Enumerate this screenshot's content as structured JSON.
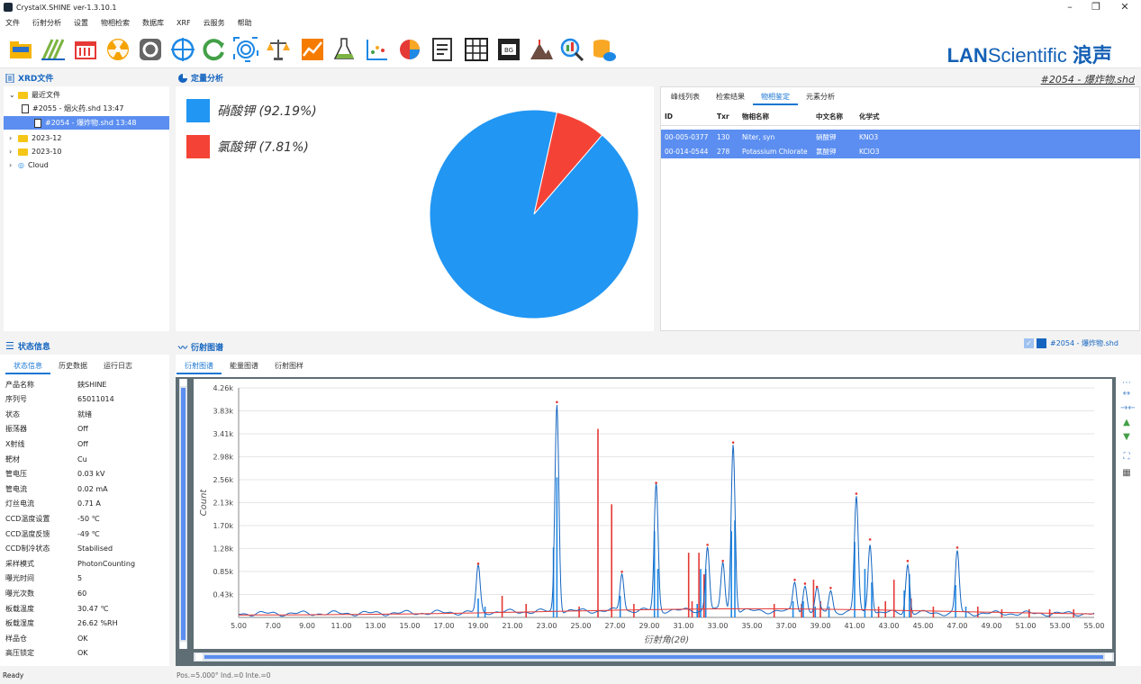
{
  "window": {
    "title": "CrystalX.SHINE  ver-1.3.10.1"
  },
  "menu": [
    "文件",
    "衍射分析",
    "设置",
    "物相检索",
    "数据库",
    "XRF",
    "云服务",
    "帮助"
  ],
  "toolbar_icons": [
    "folder-icon",
    "grid-icon",
    "calendar-icon",
    "radiation-icon",
    "gear-icon",
    "crosshair-icon",
    "refresh-icon",
    "fingerprint-icon",
    "balance-icon",
    "line-chart-icon",
    "flask-icon",
    "scatter-icon",
    "pie-icon",
    "report-icon",
    "table-icon",
    "bg-icon",
    "mountain-icon",
    "magnifier-icon",
    "database-cloud-icon"
  ],
  "brand": {
    "bold": "LAN",
    "rest": "Scientific",
    "cn": "浪声"
  },
  "xrd_files": {
    "header": "XRD文件",
    "recent": "最近文件",
    "files": [
      "#2055 - 烟火药.shd 13:47",
      "#2054 - 爆炸物.shd 13:48"
    ],
    "folders": [
      "2023-12",
      "2023-10",
      "Cloud"
    ]
  },
  "quant": {
    "header": "定量分析",
    "legend": [
      {
        "label": "硝酸钾 (92.19%)",
        "color": "#2196f3"
      },
      {
        "label": "氯酸钾 (7.81%)",
        "color": "#f44336"
      }
    ],
    "chart_data": {
      "type": "pie",
      "labels": [
        "硝酸钾",
        "氯酸钾"
      ],
      "values": [
        92.19,
        7.81
      ],
      "colors": [
        "#2196f3",
        "#f44336"
      ]
    }
  },
  "file_title": "#2054 - 爆炸物.shd",
  "result_tabs": [
    "峰线列表",
    "检索结果",
    "物相鉴定",
    "元素分析"
  ],
  "result_table": {
    "headers": [
      "ID",
      "Txr",
      "物相名称",
      "中文名称",
      "化学式"
    ],
    "rows": [
      [
        "00-005-0377",
        "130",
        "Niter, syn",
        "硝酸钾",
        "KNO3"
      ],
      [
        "00-014-0544",
        "278",
        "Potassium Chlorate",
        "氯酸钾",
        "KClO3"
      ]
    ]
  },
  "status": {
    "header": "状态信息",
    "tabs": [
      "状态信息",
      "历史数据",
      "运行日志"
    ],
    "items": [
      [
        "产品名称",
        "鉠SHINE"
      ],
      [
        "序列号",
        "65011014"
      ],
      [
        "状态",
        "就绪"
      ],
      [
        "振荡器",
        "Off"
      ],
      [
        "X射线",
        "Off"
      ],
      [
        "靶材",
        "Cu"
      ],
      [
        "管电压",
        "0.03 kV"
      ],
      [
        "管电流",
        "0.02 mA"
      ],
      [
        "灯丝电流",
        "0.71 A"
      ],
      [
        "CCD温度设置",
        "-50 ℃"
      ],
      [
        "CCD温度反馈",
        "-49 ℃"
      ],
      [
        "CCD制冷状态",
        "Stabilised"
      ],
      [
        "采样模式",
        "PhotonCounting"
      ],
      [
        "曝光时间",
        "5"
      ],
      [
        "曝光次数",
        "60"
      ],
      [
        "板载温度",
        "30.47 ℃"
      ],
      [
        "板载湿度",
        "26.62 %RH"
      ],
      [
        "样品仓",
        "OK"
      ],
      [
        "高压锁定",
        "OK"
      ]
    ]
  },
  "diffraction": {
    "header": "衍射图谱",
    "tabs": [
      "衍射图谱",
      "能量图谱",
      "衍射图样"
    ],
    "legend_label": "#2054 - 爆炸物.shd",
    "chart_data": {
      "type": "line",
      "xlabel": "衍射角(2θ)",
      "ylabel": "Count",
      "xlim": [
        5,
        55
      ],
      "ylim": [
        0,
        4260
      ],
      "x_ticks": [
        "5.00",
        "7.00",
        "9.00",
        "11.00",
        "13.00",
        "15.00",
        "17.00",
        "19.00",
        "21.00",
        "23.00",
        "25.00",
        "27.00",
        "29.00",
        "31.00",
        "33.00",
        "35.00",
        "37.00",
        "39.00",
        "41.00",
        "43.00",
        "45.00",
        "47.00",
        "49.00",
        "51.00",
        "53.00",
        "55.00"
      ],
      "y_ticks": [
        "0.43k",
        "0.85k",
        "1.28k",
        "1.70k",
        "2.13k",
        "2.56k",
        "2.98k",
        "3.41k",
        "3.83k",
        "4.26k"
      ],
      "peaks": [
        [
          19.0,
          850
        ],
        [
          23.6,
          3850
        ],
        [
          27.4,
          700
        ],
        [
          29.4,
          2350
        ],
        [
          32.4,
          1200
        ],
        [
          33.3,
          900
        ],
        [
          33.9,
          3100
        ],
        [
          37.5,
          550
        ],
        [
          38.1,
          480
        ],
        [
          38.8,
          420
        ],
        [
          39.6,
          400
        ],
        [
          41.1,
          2150
        ],
        [
          41.9,
          1300
        ],
        [
          44.1,
          900
        ],
        [
          47.0,
          1150
        ]
      ],
      "ref_blue": [
        [
          19.0,
          350
        ],
        [
          19.4,
          200
        ],
        [
          23.4,
          1300
        ],
        [
          23.6,
          2600
        ],
        [
          27.3,
          400
        ],
        [
          29.3,
          1600
        ],
        [
          29.5,
          900
        ],
        [
          31.8,
          250
        ],
        [
          32.0,
          900
        ],
        [
          32.3,
          900
        ],
        [
          33.8,
          1600
        ],
        [
          34.0,
          1800
        ],
        [
          37.4,
          300
        ],
        [
          38.0,
          300
        ],
        [
          38.7,
          200
        ],
        [
          39.5,
          200
        ],
        [
          41.0,
          1400
        ],
        [
          41.6,
          900
        ],
        [
          42.0,
          650
        ],
        [
          43.9,
          500
        ],
        [
          44.2,
          800
        ],
        [
          46.9,
          600
        ],
        [
          47.5,
          200
        ]
      ],
      "ref_red": [
        [
          20.4,
          400
        ],
        [
          21.8,
          250
        ],
        [
          24.9,
          200
        ],
        [
          26.0,
          3500
        ],
        [
          26.8,
          2100
        ],
        [
          28.1,
          250
        ],
        [
          31.3,
          1200
        ],
        [
          31.5,
          300
        ],
        [
          31.9,
          1200
        ],
        [
          32.2,
          800
        ],
        [
          36.3,
          250
        ],
        [
          37.9,
          250
        ],
        [
          38.6,
          700
        ],
        [
          39.0,
          300
        ],
        [
          42.4,
          200
        ],
        [
          42.8,
          300
        ],
        [
          43.3,
          700
        ],
        [
          44.3,
          350
        ],
        [
          45.6,
          200
        ],
        [
          48.2,
          200
        ],
        [
          49.6,
          150
        ],
        [
          51.2,
          150
        ],
        [
          52.4,
          150
        ],
        [
          53.8,
          150
        ]
      ]
    }
  },
  "statusbar": {
    "ready": "Ready",
    "pos": "Pos.=5.000°  Ind.=0  Inte.=0"
  }
}
